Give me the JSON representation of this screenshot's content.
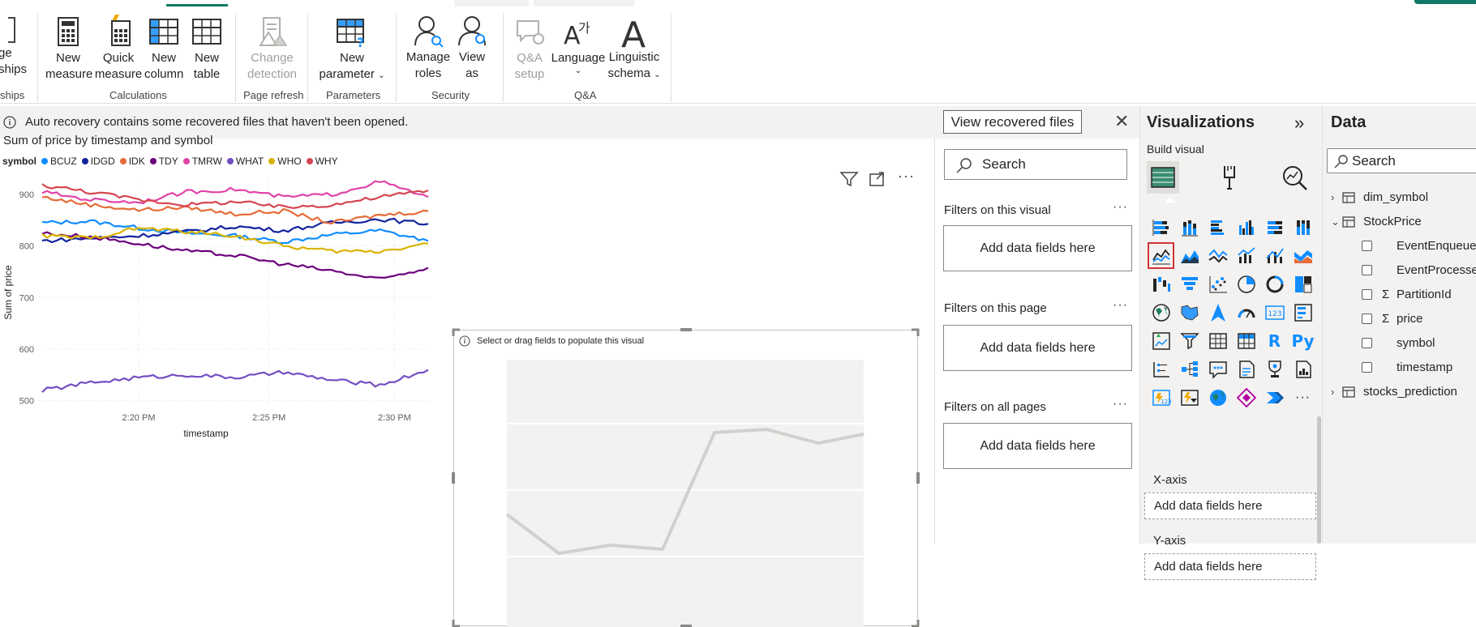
{
  "ribbon": {
    "groups": [
      {
        "label": "ships",
        "buttons": [
          {
            "label": "ge\nships"
          }
        ]
      },
      {
        "label": "Calculations",
        "buttons": [
          {
            "label": "New\nmeasure"
          },
          {
            "label": "Quick\nmeasure"
          },
          {
            "label": "New\ncolumn"
          },
          {
            "label": "New\ntable"
          }
        ]
      },
      {
        "label": "Page refresh",
        "buttons": [
          {
            "label": "Change\ndetection"
          }
        ]
      },
      {
        "label": "Parameters",
        "buttons": [
          {
            "label": "New\nparameter"
          }
        ]
      },
      {
        "label": "Security",
        "buttons": [
          {
            "label": "Manage\nroles"
          },
          {
            "label": "View\nas"
          }
        ]
      },
      {
        "label": "Q&A",
        "buttons": [
          {
            "label": "Q&A\nsetup"
          },
          {
            "label": "Language"
          },
          {
            "label": "Linguistic\nschema"
          }
        ]
      }
    ]
  },
  "infobar": {
    "message": "Auto recovery contains some recovered files that haven't been opened.",
    "view_button": "View recovered files"
  },
  "canvas": {
    "empty_visual_hint": "Select or drag fields to populate this visual"
  },
  "chart_data": {
    "type": "line",
    "title": "Sum of price by timestamp and symbol",
    "xlabel": "timestamp",
    "ylabel": "Sum of price",
    "legend_title": "symbol",
    "legend_position": "top-left",
    "x_ticks": [
      "2:20 PM",
      "2:25 PM",
      "2:30 PM"
    ],
    "y_ticks": [
      500,
      600,
      700,
      800,
      900
    ],
    "ylim": [
      490,
      930
    ],
    "x": [
      "2:16 PM",
      "2:18 PM",
      "2:20 PM",
      "2:22 PM",
      "2:24 PM",
      "2:26 PM",
      "2:28 PM",
      "2:30 PM",
      "2:31 PM"
    ],
    "series": [
      {
        "name": "BCUZ",
        "color": "#118DFF",
        "values": [
          845,
          848,
          835,
          825,
          820,
          808,
          822,
          830,
          810
        ]
      },
      {
        "name": "IDGD",
        "color": "#12239E",
        "values": [
          810,
          815,
          820,
          828,
          838,
          830,
          845,
          852,
          843
        ]
      },
      {
        "name": "IDK",
        "color": "#E66C37",
        "values": [
          895,
          880,
          870,
          875,
          862,
          868,
          845,
          860,
          868
        ]
      },
      {
        "name": "TDY",
        "color": "#6B007B",
        "values": [
          825,
          818,
          805,
          790,
          782,
          765,
          752,
          735,
          758
        ]
      },
      {
        "name": "TMRW",
        "color": "#E044A7",
        "values": [
          905,
          890,
          885,
          905,
          910,
          895,
          900,
          925,
          895
        ]
      },
      {
        "name": "WHAT",
        "color": "#744EC2",
        "values": [
          520,
          535,
          545,
          550,
          545,
          555,
          540,
          530,
          560
        ]
      },
      {
        "name": "WHO",
        "color": "#D9B300",
        "values": [
          820,
          815,
          835,
          828,
          820,
          800,
          790,
          790,
          805
        ]
      },
      {
        "name": "WHY",
        "color": "#D64550",
        "values": [
          918,
          905,
          890,
          880,
          886,
          875,
          880,
          895,
          908
        ]
      }
    ]
  },
  "filters": {
    "search_placeholder": "Search",
    "sections": [
      {
        "title": "Filters on this visual",
        "drop": "Add data fields here"
      },
      {
        "title": "Filters on this page",
        "drop": "Add data fields here"
      },
      {
        "title": "Filters on all pages",
        "drop": "Add data fields here"
      }
    ]
  },
  "visualizations": {
    "title": "Visualizations",
    "build_visual": "Build visual",
    "wells": [
      {
        "label": "X-axis",
        "drop": "Add data fields here"
      },
      {
        "label": "Y-axis",
        "drop": "Add data fields here"
      }
    ],
    "icons": [
      "stacked-bar",
      "stacked-column",
      "clustered-bar",
      "clustered-column",
      "100-stacked-bar",
      "100-stacked-column",
      "line-chart",
      "area-chart",
      "stacked-area",
      "line-column",
      "line-clustered-column",
      "ribbon-chart",
      "waterfall",
      "funnel",
      "scatter",
      "pie",
      "donut",
      "treemap",
      "map",
      "filled-map",
      "azure-map",
      "gauge",
      "card",
      "multirow-card",
      "kpi",
      "slicer",
      "table",
      "matrix",
      "r-visual",
      "python-visual",
      "key-influencers",
      "decomposition-tree",
      "qa",
      "smart-narrative",
      "goals",
      "paginated-report",
      "power-apps",
      "power-automate",
      "arcgis",
      "power-apps-2",
      "power-automate-2",
      "more"
    ],
    "r_label": "R",
    "py_label": "Py",
    "more_label": "···"
  },
  "data_pane": {
    "title": "Data",
    "search_placeholder": "Search",
    "tables": [
      {
        "name": "dim_symbol",
        "expanded": false,
        "fields": []
      },
      {
        "name": "StockPrice",
        "expanded": true,
        "fields": [
          {
            "name": "EventEnqueuedUtcTime",
            "sigma": false
          },
          {
            "name": "EventProcessedUtcTime",
            "sigma": false
          },
          {
            "name": "PartitionId",
            "sigma": true
          },
          {
            "name": "price",
            "sigma": true
          },
          {
            "name": "symbol",
            "sigma": false
          },
          {
            "name": "timestamp",
            "sigma": false
          }
        ]
      },
      {
        "name": "stocks_prediction",
        "expanded": false,
        "fields": []
      }
    ]
  }
}
